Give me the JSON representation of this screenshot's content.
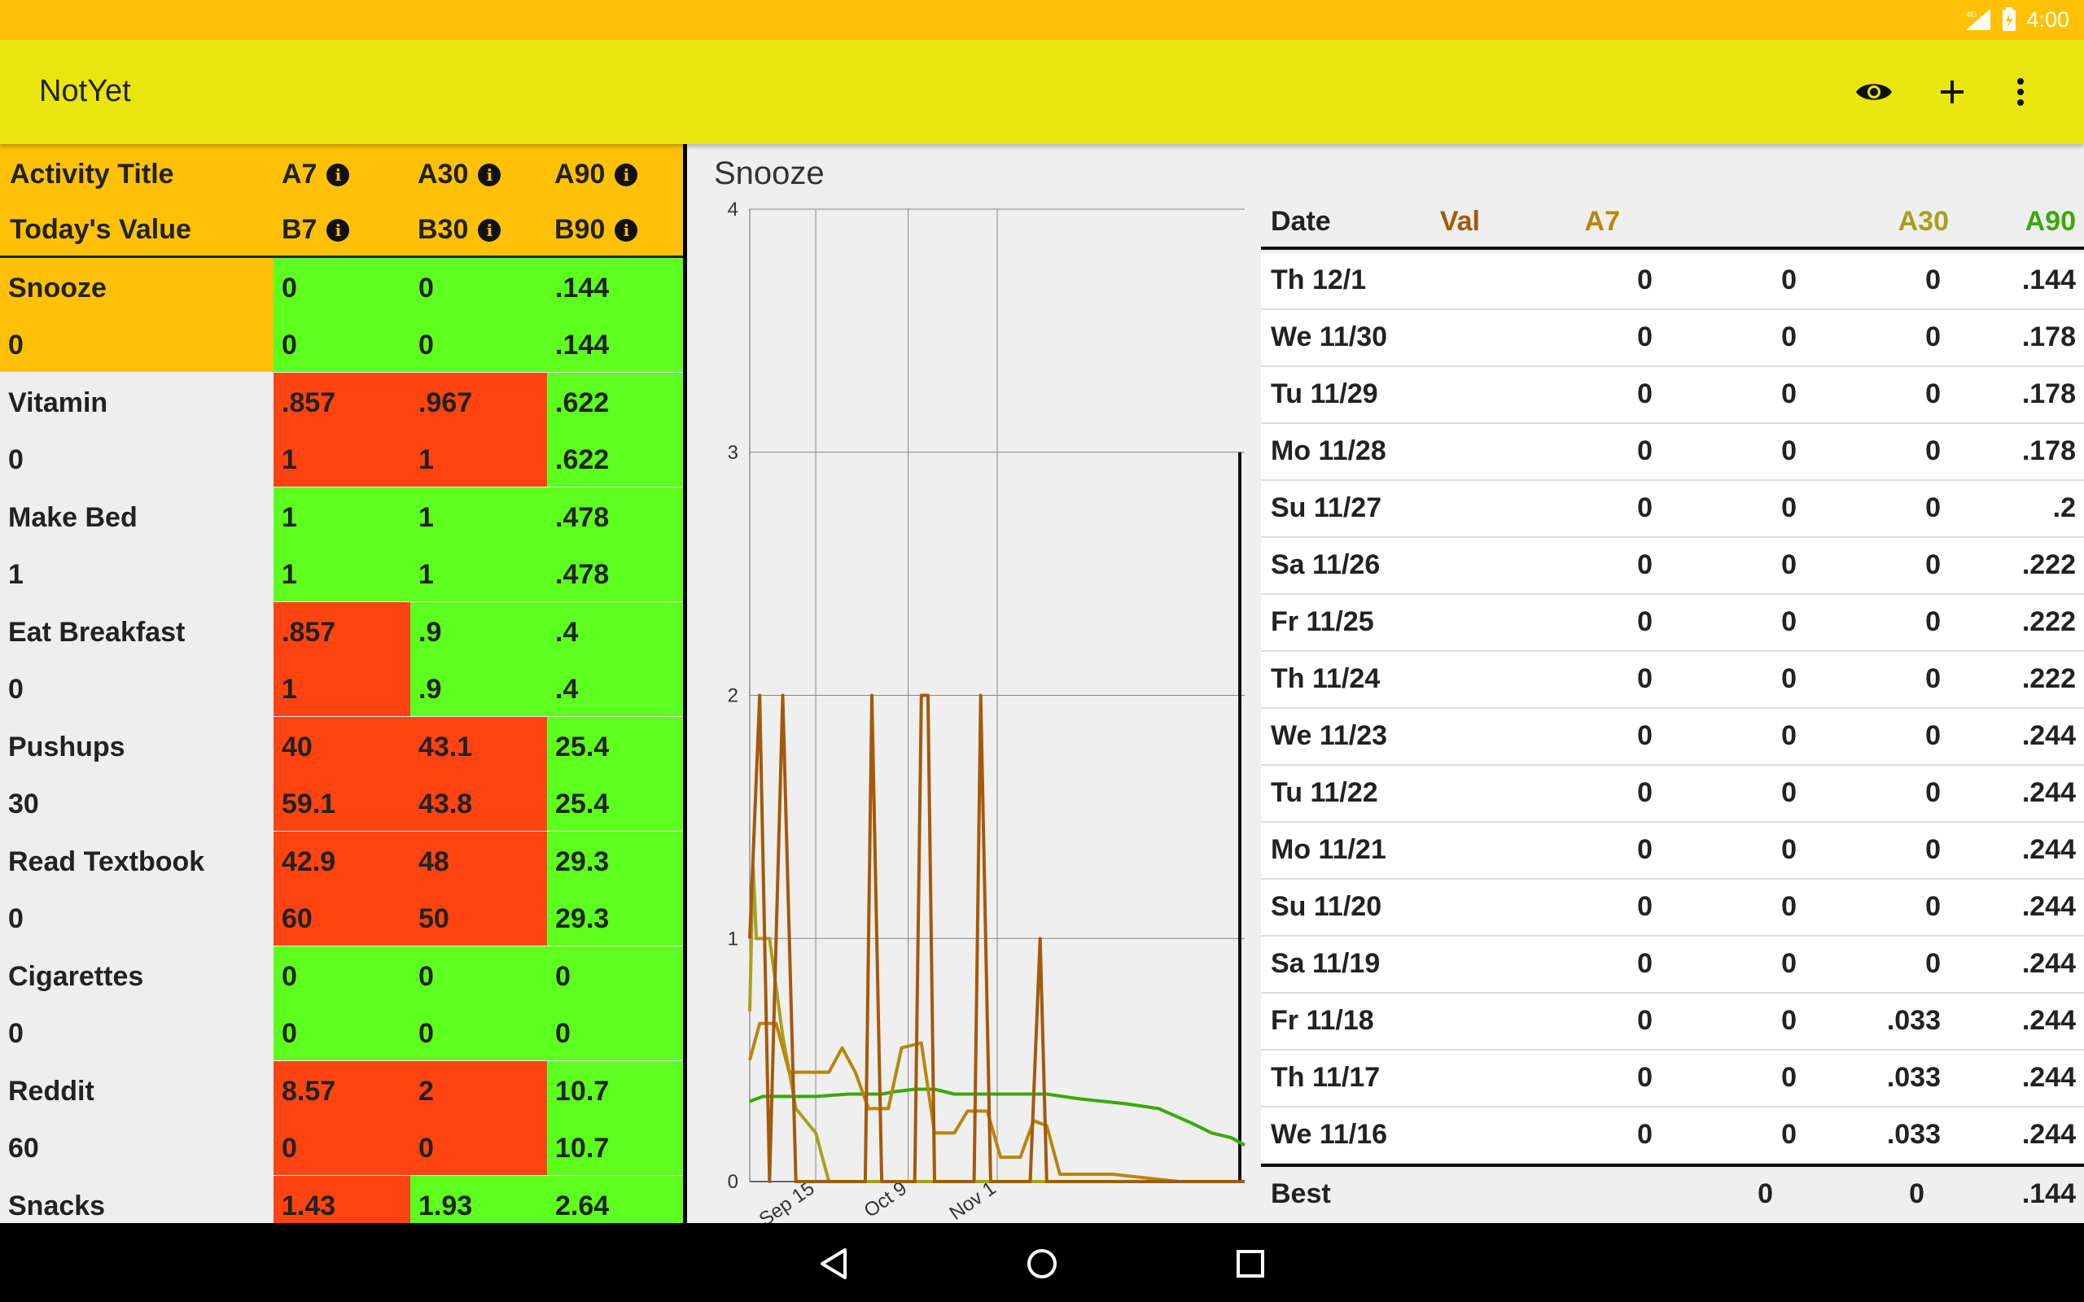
{
  "status_bar": {
    "network": "4G",
    "time": "4:00"
  },
  "app_bar": {
    "title": "NotYet",
    "icons": [
      "eye-icon",
      "plus-icon",
      "overflow-menu-icon"
    ]
  },
  "colors": {
    "status_bar": "#ffc107",
    "app_bar": "#e9e60e",
    "header": "#ffc107",
    "good": "#5cff1d",
    "bad": "#ff4412",
    "neutral": "#eeeeee",
    "val": "#a35a0c",
    "a7": "#b8860b",
    "a30": "#a8a020",
    "a90": "#3aa80a"
  },
  "grid": {
    "header": {
      "title": "Activity Title",
      "today": "Today's Value",
      "a7": "A7",
      "a30": "A30",
      "a90": "A90",
      "b7": "B7",
      "b30": "B30",
      "b90": "B90"
    },
    "rows": [
      {
        "name": "Snooze",
        "today": "0",
        "a7": "0",
        "a30": "0",
        "a90": ".144",
        "b7": "0",
        "b30": "0",
        "b90": ".144",
        "selected": true,
        "c7": "good",
        "c30": "good",
        "c90": "good"
      },
      {
        "name": "Vitamin",
        "today": "0",
        "a7": ".857",
        "a30": ".967",
        "a90": ".622",
        "b7": "1",
        "b30": "1",
        "b90": ".622",
        "c7": "bad",
        "c30": "bad",
        "c90": "good"
      },
      {
        "name": "Make Bed",
        "today": "1",
        "a7": "1",
        "a30": "1",
        "a90": ".478",
        "b7": "1",
        "b30": "1",
        "b90": ".478",
        "c7": "good",
        "c30": "good",
        "c90": "good"
      },
      {
        "name": "Eat Breakfast",
        "today": "0",
        "a7": ".857",
        "a30": ".9",
        "a90": ".4",
        "b7": "1",
        "b30": ".9",
        "b90": ".4",
        "c7": "bad",
        "c30": "good",
        "c90": "good"
      },
      {
        "name": "Pushups",
        "today": "30",
        "a7": "40",
        "a30": "43.1",
        "a90": "25.4",
        "b7": "59.1",
        "b30": "43.8",
        "b90": "25.4",
        "c7": "bad",
        "c30": "bad",
        "c90": "good"
      },
      {
        "name": "Read Textbook",
        "today": "0",
        "a7": "42.9",
        "a30": "48",
        "a90": "29.3",
        "b7": "60",
        "b30": "50",
        "b90": "29.3",
        "c7": "bad",
        "c30": "bad",
        "c90": "good"
      },
      {
        "name": "Cigarettes",
        "today": "0",
        "a7": "0",
        "a30": "0",
        "a90": "0",
        "b7": "0",
        "b30": "0",
        "b90": "0",
        "c7": "good",
        "c30": "good",
        "c90": "good"
      },
      {
        "name": "Reddit",
        "today": "60",
        "a7": "8.57",
        "a30": "2",
        "a90": "10.7",
        "b7": "0",
        "b30": "0",
        "b90": "10.7",
        "c7": "bad",
        "c30": "bad",
        "c90": "good"
      },
      {
        "name": "Snacks",
        "today": "",
        "a7": "1.43",
        "a30": "1.93",
        "a90": "2.64",
        "b7": "",
        "b30": "",
        "b90": "",
        "c7": "bad",
        "c30": "good",
        "c90": "good"
      }
    ]
  },
  "chart_data": {
    "type": "line",
    "title": "Snooze",
    "ylim": [
      0,
      4
    ],
    "yticks": [
      "0",
      "1",
      "2",
      "3",
      "4"
    ],
    "xticks": [
      "Sep 15",
      "Oct 9",
      "Nov 1"
    ],
    "series": [
      {
        "name": "Val",
        "color": "#a35a0c",
        "points": [
          [
            0,
            1
          ],
          [
            3,
            2
          ],
          [
            6,
            0
          ],
          [
            10,
            2
          ],
          [
            14,
            0
          ],
          [
            22,
            0
          ],
          [
            30,
            0
          ],
          [
            35,
            0
          ],
          [
            37,
            2
          ],
          [
            40,
            0
          ],
          [
            50,
            0
          ],
          [
            52,
            2
          ],
          [
            54,
            2
          ],
          [
            56,
            0
          ],
          [
            65,
            0
          ],
          [
            68,
            0
          ],
          [
            70,
            2
          ],
          [
            73,
            0
          ],
          [
            85,
            0
          ],
          [
            88,
            1
          ],
          [
            90,
            0
          ],
          [
            100,
            0
          ],
          [
            125,
            0
          ],
          [
            150,
            0
          ]
        ]
      },
      {
        "name": "A7",
        "color": "#b8860b",
        "points": [
          [
            0,
            0.5
          ],
          [
            3,
            0.65
          ],
          [
            8,
            0.65
          ],
          [
            12,
            0.45
          ],
          [
            18,
            0.45
          ],
          [
            24,
            0.45
          ],
          [
            28,
            0.55
          ],
          [
            32,
            0.45
          ],
          [
            36,
            0.3
          ],
          [
            42,
            0.3
          ],
          [
            46,
            0.55
          ],
          [
            52,
            0.57
          ],
          [
            56,
            0.2
          ],
          [
            62,
            0.2
          ],
          [
            66,
            0.29
          ],
          [
            72,
            0.29
          ],
          [
            76,
            0.1
          ],
          [
            82,
            0.1
          ],
          [
            86,
            0.25
          ],
          [
            90,
            0.23
          ],
          [
            94,
            0.03
          ],
          [
            110,
            0.03
          ],
          [
            130,
            0.0
          ],
          [
            150,
            0.0
          ]
        ]
      },
      {
        "name": "A30",
        "color": "#a8a020",
        "points": [
          [
            0,
            0.7
          ],
          [
            1,
            1.3
          ],
          [
            2,
            1.0
          ],
          [
            6,
            1.0
          ],
          [
            10,
            0.6
          ],
          [
            14,
            0.3
          ],
          [
            20,
            0.2
          ],
          [
            24,
            0.0
          ],
          [
            30,
            0.0
          ],
          [
            40,
            0.0
          ],
          [
            150,
            0.0
          ]
        ]
      },
      {
        "name": "A90",
        "color": "#3aa80a",
        "points": [
          [
            0,
            0.33
          ],
          [
            4,
            0.35
          ],
          [
            14,
            0.35
          ],
          [
            20,
            0.35
          ],
          [
            30,
            0.36
          ],
          [
            40,
            0.36
          ],
          [
            44,
            0.37
          ],
          [
            50,
            0.38
          ],
          [
            56,
            0.38
          ],
          [
            62,
            0.36
          ],
          [
            72,
            0.36
          ],
          [
            90,
            0.36
          ],
          [
            100,
            0.34
          ],
          [
            114,
            0.32
          ],
          [
            124,
            0.3
          ],
          [
            134,
            0.24
          ],
          [
            140,
            0.2
          ],
          [
            146,
            0.18
          ],
          [
            150,
            0.15
          ]
        ]
      }
    ]
  },
  "table": {
    "headers": {
      "date": "Date",
      "val": "Val",
      "a7": "A7",
      "a30": "A30",
      "a90": "A90"
    },
    "rows": [
      {
        "date": "Th 12/1",
        "val": "0",
        "a7": "0",
        "a30": "0",
        "a90": ".144"
      },
      {
        "date": "We 11/30",
        "val": "0",
        "a7": "0",
        "a30": "0",
        "a90": ".178"
      },
      {
        "date": "Tu 11/29",
        "val": "0",
        "a7": "0",
        "a30": "0",
        "a90": ".178"
      },
      {
        "date": "Mo 11/28",
        "val": "0",
        "a7": "0",
        "a30": "0",
        "a90": ".178"
      },
      {
        "date": "Su 11/27",
        "val": "0",
        "a7": "0",
        "a30": "0",
        "a90": ".2"
      },
      {
        "date": "Sa 11/26",
        "val": "0",
        "a7": "0",
        "a30": "0",
        "a90": ".222"
      },
      {
        "date": "Fr 11/25",
        "val": "0",
        "a7": "0",
        "a30": "0",
        "a90": ".222"
      },
      {
        "date": "Th 11/24",
        "val": "0",
        "a7": "0",
        "a30": "0",
        "a90": ".222"
      },
      {
        "date": "We 11/23",
        "val": "0",
        "a7": "0",
        "a30": "0",
        "a90": ".244"
      },
      {
        "date": "Tu 11/22",
        "val": "0",
        "a7": "0",
        "a30": "0",
        "a90": ".244"
      },
      {
        "date": "Mo 11/21",
        "val": "0",
        "a7": "0",
        "a30": "0",
        "a90": ".244"
      },
      {
        "date": "Su 11/20",
        "val": "0",
        "a7": "0",
        "a30": "0",
        "a90": ".244"
      },
      {
        "date": "Sa 11/19",
        "val": "0",
        "a7": "0",
        "a30": "0",
        "a90": ".244"
      },
      {
        "date": "Fr 11/18",
        "val": "0",
        "a7": "0",
        "a30": ".033",
        "a90": ".244"
      },
      {
        "date": "Th 11/17",
        "val": "0",
        "a7": "0",
        "a30": ".033",
        "a90": ".244"
      },
      {
        "date": "We 11/16",
        "val": "0",
        "a7": "0",
        "a30": ".033",
        "a90": ".244"
      }
    ],
    "footer": {
      "label": "Best",
      "a7": "0",
      "a30": "0",
      "a90": ".144"
    }
  },
  "nav_bar": {
    "icons": [
      "back-icon",
      "home-icon",
      "recents-icon"
    ]
  }
}
